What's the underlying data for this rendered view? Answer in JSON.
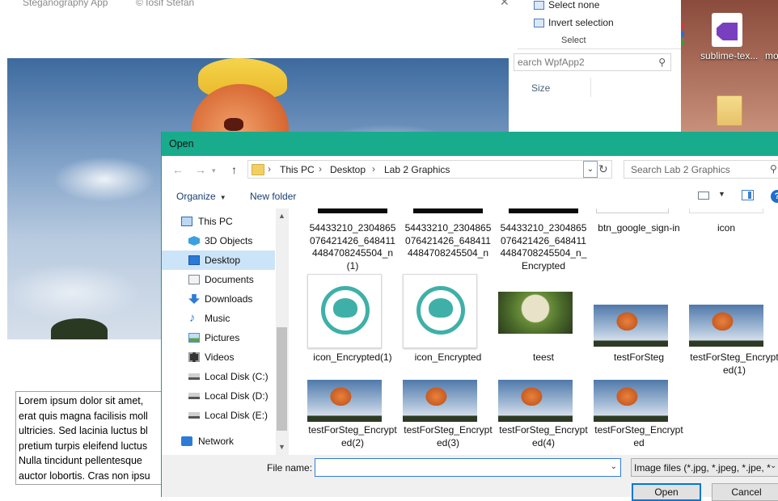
{
  "app": {
    "title": "Steganography App",
    "author": "© Iosif Stefan",
    "close_glyph": "✕",
    "text_lines": [
      "Lorem ipsum dolor sit amet,",
      "erat quis magna facilisis moll",
      "ultricies. Sed lacinia luctus bl",
      "pretium turpis eleifend luctus",
      "Nulla tincidunt pellentesque",
      "auctor lobortis. Cras non ipsu"
    ]
  },
  "explorer": {
    "select_none": "Select none",
    "invert_selection": "Invert selection",
    "group_label": "Select",
    "search_placeholder": "earch WpfApp2",
    "size_column": "Size"
  },
  "desktop": {
    "items": [
      {
        "label": "sublime-tex...",
        "icon": "visual-studio-icon"
      },
      {
        "label": "mo",
        "icon": "file-icon"
      }
    ]
  },
  "dialog": {
    "title": "Open",
    "breadcrumb": [
      "This PC",
      "Desktop",
      "Lab 2 Graphics"
    ],
    "search_placeholder": "Search Lab 2 Graphics",
    "organize_label": "Organize",
    "new_folder_label": "New folder",
    "help_glyph": "?",
    "nav_items": [
      {
        "label": "This PC",
        "icon": "computer-icon"
      },
      {
        "label": "3D Objects",
        "icon": "3d-objects-icon"
      },
      {
        "label": "Desktop",
        "icon": "desktop-icon",
        "selected": true
      },
      {
        "label": "Documents",
        "icon": "documents-icon"
      },
      {
        "label": "Downloads",
        "icon": "downloads-icon"
      },
      {
        "label": "Music",
        "icon": "music-icon"
      },
      {
        "label": "Pictures",
        "icon": "pictures-icon"
      },
      {
        "label": "Videos",
        "icon": "videos-icon"
      },
      {
        "label": "Local Disk (C:)",
        "icon": "disk-icon"
      },
      {
        "label": "Local Disk (D:)",
        "icon": "disk-icon"
      },
      {
        "label": "Local Disk (E:)",
        "icon": "disk-icon"
      },
      {
        "label": "Network",
        "icon": "network-icon"
      }
    ],
    "files": [
      {
        "name": "54433210_2304865076421426_6484114484708245504_n (1)",
        "thumb": "black"
      },
      {
        "name": "54433210_2304865076421426_6484114484708245504_n",
        "thumb": "black"
      },
      {
        "name": "54433210_2304865076421426_6484114484708245504_n_Encrypted",
        "thumb": "black"
      },
      {
        "name": "btn_google_sign-in",
        "thumb": "google"
      },
      {
        "name": "icon",
        "thumb": "blank"
      },
      {
        "name": "icon_Encrypted(1)",
        "thumb": "elephant"
      },
      {
        "name": "icon_Encrypted",
        "thumb": "elephant"
      },
      {
        "name": "teest",
        "thumb": "teest"
      },
      {
        "name": "testForSteg",
        "thumb": "steg"
      },
      {
        "name": "testForSteg_Encrypted(1)",
        "thumb": "steg"
      },
      {
        "name": "testForSteg_Encrypted(2)",
        "thumb": "steg"
      },
      {
        "name": "testForSteg_Encrypted(3)",
        "thumb": "steg"
      },
      {
        "name": "testForSteg_Encrypted(4)",
        "thumb": "steg"
      },
      {
        "name": "testForSteg_Encrypted",
        "thumb": "steg"
      }
    ],
    "file_name_label": "File name:",
    "file_name_value": "",
    "file_type": "Image files (*.jpg, *.jpeg, *.jpe, *",
    "open_label": "Open",
    "cancel_label": "Cancel"
  },
  "colors": {
    "dialog_title_bar": "#18ac8c",
    "selection": "#cce4f7",
    "accent": "#0078d7"
  }
}
